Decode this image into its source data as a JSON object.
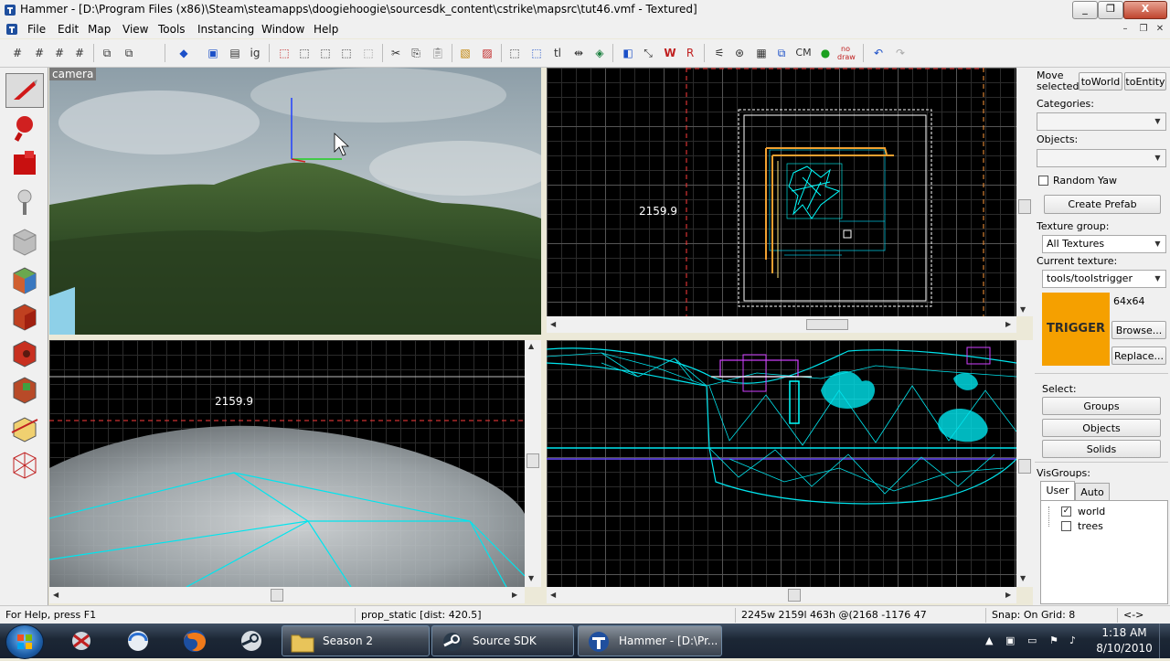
{
  "window": {
    "title": "Hammer - [D:\\Program Files (x86)\\Steam\\steamapps\\doogiehoogie\\sourcesdk_content\\cstrike\\mapsrc\\tut46.vmf - Textured]",
    "minimize": "_",
    "restore": "❐",
    "close": "X"
  },
  "menu": {
    "items": [
      "File",
      "Edit",
      "Map",
      "View",
      "Tools",
      "Instancing",
      "Window",
      "Help"
    ],
    "mdi_minimize": "–",
    "mdi_restore": "❐",
    "mdi_close": "✕"
  },
  "toolbar": {
    "glyphs": {
      "cordon": "CM",
      "undo": "↶",
      "redo": "↷"
    }
  },
  "viewports": {
    "camera": {
      "label": "camera"
    },
    "top": {
      "coord": "2159.9"
    },
    "front": {
      "coord": "2159.9"
    }
  },
  "right_panel": {
    "move_selected": "Move selected:",
    "to_world": "toWorld",
    "to_entity": "toEntity",
    "categories_label": "Categories:",
    "objects_label": "Objects:",
    "random_yaw": "Random Yaw",
    "create_prefab": "Create Prefab",
    "texture_group_label": "Texture group:",
    "texture_group_value": "All Textures",
    "current_texture_label": "Current texture:",
    "current_texture_value": "tools/toolstrigger",
    "texture_preview_text": "TRIGGER",
    "texture_size": "64x64",
    "browse": "Browse...",
    "replace": "Replace...",
    "select_label": "Select:",
    "select_groups": "Groups",
    "select_objects": "Objects",
    "select_solids": "Solids",
    "visgroups_label": "VisGroups:",
    "vis_tabs": [
      "User",
      "Auto"
    ],
    "vis_items": [
      {
        "name": "world",
        "checked": true
      },
      {
        "name": "trees",
        "checked": false
      }
    ],
    "texture_color": "#f5a000"
  },
  "statusbar": {
    "help": "For Help, press F1",
    "selection": "prop_static   [dist: 420.5]",
    "size": "2245w 2159l 463h @(2168 -1176 47",
    "snap": "Snap: On Grid: 8",
    "extra": "<->"
  },
  "taskbar": {
    "buttons": [
      {
        "label": "Season 2",
        "icon": "folder-icon"
      },
      {
        "label": "Source SDK",
        "icon": "steam-icon"
      },
      {
        "label": "Hammer - [D:\\Pr...",
        "icon": "hammer-icon"
      }
    ],
    "time": "1:18 AM",
    "date": "8/10/2010"
  },
  "colors": {
    "wire_cyan": "#00ffff",
    "grid_red": "#ff3b3b",
    "selection_white": "#ffffff",
    "entity_magenta": "#d040ff",
    "brush_orange": "#f0a030"
  }
}
